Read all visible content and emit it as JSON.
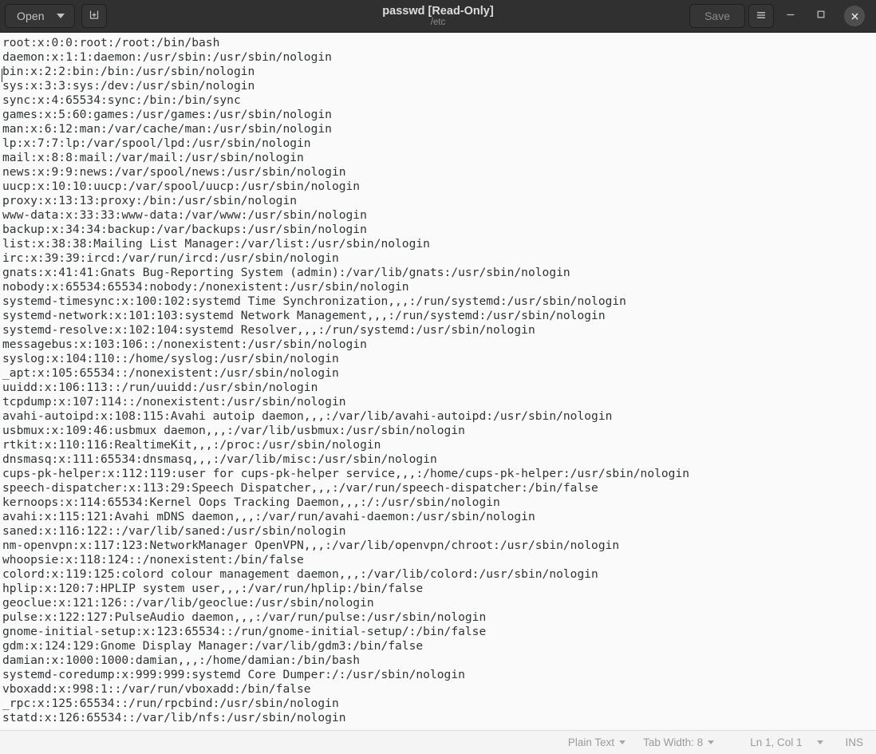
{
  "window": {
    "title": "passwd [Read-Only]",
    "subtitle": "/etc"
  },
  "headerbar": {
    "open_label": "Open",
    "open_caret_icon": "chevron-down-icon",
    "new_tab_icon": "new-document-icon",
    "save_label": "Save",
    "menu_icon": "hamburger-menu-icon",
    "minimize_icon": "minimize-icon",
    "maximize_icon": "maximize-icon",
    "close_icon": "close-icon"
  },
  "editor": {
    "lines": [
      "root:x:0:0:root:/root:/bin/bash",
      "daemon:x:1:1:daemon:/usr/sbin:/usr/sbin/nologin",
      "bin:x:2:2:bin:/bin:/usr/sbin/nologin",
      "sys:x:3:3:sys:/dev:/usr/sbin/nologin",
      "sync:x:4:65534:sync:/bin:/bin/sync",
      "games:x:5:60:games:/usr/games:/usr/sbin/nologin",
      "man:x:6:12:man:/var/cache/man:/usr/sbin/nologin",
      "lp:x:7:7:lp:/var/spool/lpd:/usr/sbin/nologin",
      "mail:x:8:8:mail:/var/mail:/usr/sbin/nologin",
      "news:x:9:9:news:/var/spool/news:/usr/sbin/nologin",
      "uucp:x:10:10:uucp:/var/spool/uucp:/usr/sbin/nologin",
      "proxy:x:13:13:proxy:/bin:/usr/sbin/nologin",
      "www-data:x:33:33:www-data:/var/www:/usr/sbin/nologin",
      "backup:x:34:34:backup:/var/backups:/usr/sbin/nologin",
      "list:x:38:38:Mailing List Manager:/var/list:/usr/sbin/nologin",
      "irc:x:39:39:ircd:/var/run/ircd:/usr/sbin/nologin",
      "gnats:x:41:41:Gnats Bug-Reporting System (admin):/var/lib/gnats:/usr/sbin/nologin",
      "nobody:x:65534:65534:nobody:/nonexistent:/usr/sbin/nologin",
      "systemd-timesync:x:100:102:systemd Time Synchronization,,,:/run/systemd:/usr/sbin/nologin",
      "systemd-network:x:101:103:systemd Network Management,,,:/run/systemd:/usr/sbin/nologin",
      "systemd-resolve:x:102:104:systemd Resolver,,,:/run/systemd:/usr/sbin/nologin",
      "messagebus:x:103:106::/nonexistent:/usr/sbin/nologin",
      "syslog:x:104:110::/home/syslog:/usr/sbin/nologin",
      "_apt:x:105:65534::/nonexistent:/usr/sbin/nologin",
      "uuidd:x:106:113::/run/uuidd:/usr/sbin/nologin",
      "tcpdump:x:107:114::/nonexistent:/usr/sbin/nologin",
      "avahi-autoipd:x:108:115:Avahi autoip daemon,,,:/var/lib/avahi-autoipd:/usr/sbin/nologin",
      "usbmux:x:109:46:usbmux daemon,,,:/var/lib/usbmux:/usr/sbin/nologin",
      "rtkit:x:110:116:RealtimeKit,,,:/proc:/usr/sbin/nologin",
      "dnsmasq:x:111:65534:dnsmasq,,,:/var/lib/misc:/usr/sbin/nologin",
      "cups-pk-helper:x:112:119:user for cups-pk-helper service,,,:/home/cups-pk-helper:/usr/sbin/nologin",
      "speech-dispatcher:x:113:29:Speech Dispatcher,,,:/var/run/speech-dispatcher:/bin/false",
      "kernoops:x:114:65534:Kernel Oops Tracking Daemon,,,:/:/usr/sbin/nologin",
      "avahi:x:115:121:Avahi mDNS daemon,,,:/var/run/avahi-daemon:/usr/sbin/nologin",
      "saned:x:116:122::/var/lib/saned:/usr/sbin/nologin",
      "nm-openvpn:x:117:123:NetworkManager OpenVPN,,,:/var/lib/openvpn/chroot:/usr/sbin/nologin",
      "whoopsie:x:118:124::/nonexistent:/bin/false",
      "colord:x:119:125:colord colour management daemon,,,:/var/lib/colord:/usr/sbin/nologin",
      "hplip:x:120:7:HPLIP system user,,,:/var/run/hplip:/bin/false",
      "geoclue:x:121:126::/var/lib/geoclue:/usr/sbin/nologin",
      "pulse:x:122:127:PulseAudio daemon,,,:/var/run/pulse:/usr/sbin/nologin",
      "gnome-initial-setup:x:123:65534::/run/gnome-initial-setup/:/bin/false",
      "gdm:x:124:129:Gnome Display Manager:/var/lib/gdm3:/bin/false",
      "damian:x:1000:1000:damian,,,:/home/damian:/bin/bash",
      "systemd-coredump:x:999:999:systemd Core Dumper:/:/usr/sbin/nologin",
      "vboxadd:x:998:1::/var/run/vboxadd:/bin/false",
      "_rpc:x:125:65534::/run/rpcbind:/usr/sbin/nologin",
      "statd:x:126:65534::/var/lib/nfs:/usr/sbin/nologin"
    ]
  },
  "statusbar": {
    "language": "Plain Text",
    "tab_width": "Tab Width: 8",
    "position": "Ln 1, Col 1",
    "insert_mode": "INS",
    "caret_icon": "chevron-down-icon"
  },
  "colors": {
    "headerbar_bg": "#303030",
    "textview_bg": "#fafafa",
    "text_fg": "#2e3436",
    "statusbar_bg": "#f4f4f5",
    "statusbar_fg": "#9a9a9f"
  }
}
